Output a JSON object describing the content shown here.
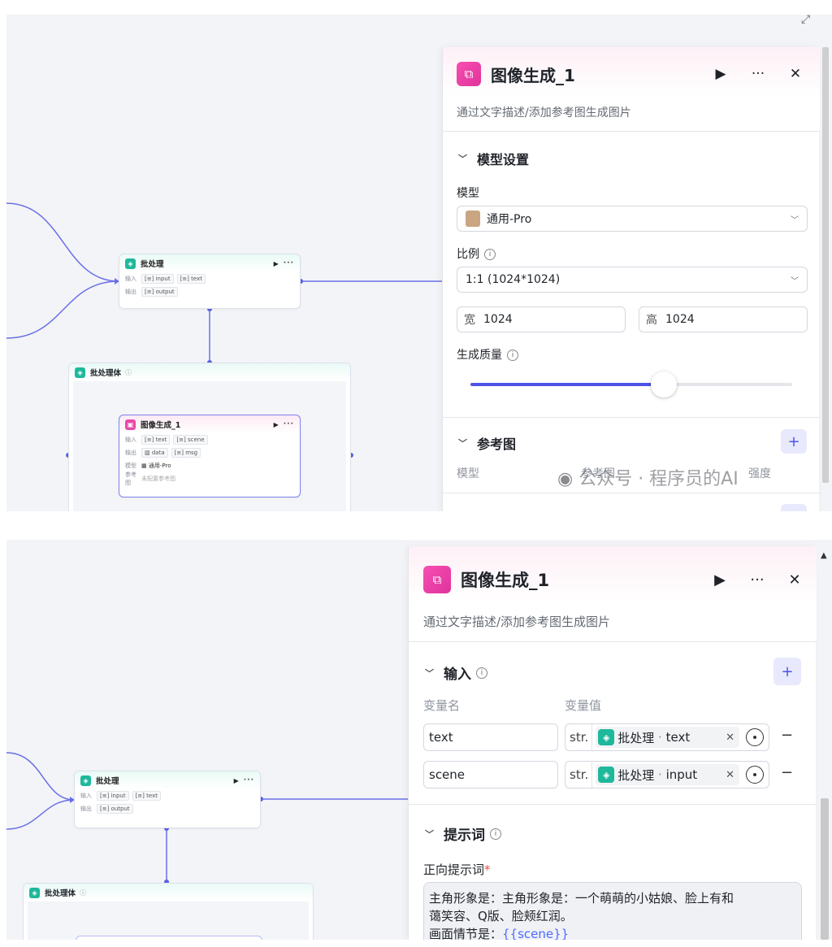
{
  "top": {
    "expand_icon": "expand-icon",
    "batch_node": {
      "title": "批处理",
      "input_label": "输入",
      "inputs": [
        "input",
        "text"
      ],
      "output_label": "输出",
      "outputs": [
        "output"
      ]
    },
    "batch_body": {
      "title": "批处理体"
    },
    "image_node": {
      "title": "图像生成_1",
      "input_label": "输入",
      "inputs": [
        "text",
        "scene"
      ],
      "output_label": "输出",
      "outputs": [
        "data",
        "msg"
      ],
      "model_label": "模型",
      "model_value": "通用-Pro",
      "ref_label": "参考图",
      "ref_value": "未配置参考图"
    },
    "panel": {
      "title": "图像生成_1",
      "description": "通过文字描述/添加参考图生成图片",
      "model_section": "模型设置",
      "model_label": "模型",
      "model_value": "通用-Pro",
      "ratio_label": "比例",
      "ratio_value": "1:1 (1024*1024)",
      "width_label": "宽",
      "width_value": "1024",
      "height_label": "高",
      "height_value": "1024",
      "quality_label": "生成质量",
      "quality_fraction": 0.6,
      "ref_section": "参考图",
      "ref_model_label": "模型",
      "ref_cols": [
        "参考图",
        "强度"
      ]
    },
    "watermark": "公众号 · 程序员的AI"
  },
  "bottom": {
    "batch_node": {
      "title": "批处理",
      "input_label": "输入",
      "inputs": [
        "input",
        "text"
      ],
      "output_label": "输出",
      "outputs": [
        "output"
      ]
    },
    "batch_body": {
      "title": "批处理体"
    },
    "panel": {
      "title": "图像生成_1",
      "description": "通过文字描述/添加参考图生成图片",
      "input_section": "输入",
      "col_name": "变量名",
      "col_value": "变量值",
      "rows": [
        {
          "name": "text",
          "type": "str.",
          "source": "批处理",
          "field": "text"
        },
        {
          "name": "scene",
          "type": "str.",
          "source": "批处理",
          "field": "input"
        }
      ],
      "prompt_section": "提示词",
      "positive_label": "正向提示词",
      "required_mark": "*",
      "prompt_line1": "主角形象是：主角形象是：一个萌萌的小姑娘、脸上有和",
      "prompt_line2": "蔼笑容、Q版、脸颊红润。",
      "prompt_line3_prefix": "画面情节是：",
      "prompt_line3_var": "{{scene}}"
    }
  }
}
